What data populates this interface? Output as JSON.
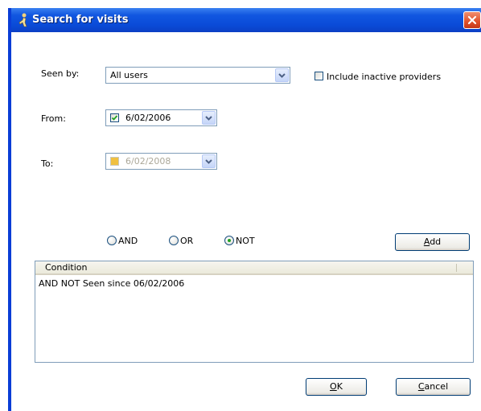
{
  "window": {
    "title": "Search for visits"
  },
  "seen_by": {
    "label": "Seen by:",
    "value": "All users"
  },
  "include_inactive": {
    "label": "Include inactive providers",
    "checked": false
  },
  "from": {
    "label": "From:",
    "value": "6/02/2006",
    "checked": true
  },
  "to": {
    "label": "To:",
    "value": "6/02/2008",
    "checked": false
  },
  "operators": [
    {
      "label": "AND",
      "selected": false
    },
    {
      "label": "OR",
      "selected": false
    },
    {
      "label": "NOT",
      "selected": true
    }
  ],
  "buttons": {
    "add_first": "A",
    "add_rest": "dd",
    "ok_first": "O",
    "ok_rest": "K",
    "cancel_first": "C",
    "cancel_rest": "ancel"
  },
  "conditions": {
    "header": "Condition",
    "rows": [
      "AND NOT Seen since 06/02/2006"
    ]
  },
  "colors": {
    "titlebar": "#0a4bd8",
    "check_mark": "#21a121",
    "close_button": "#e0502a"
  }
}
